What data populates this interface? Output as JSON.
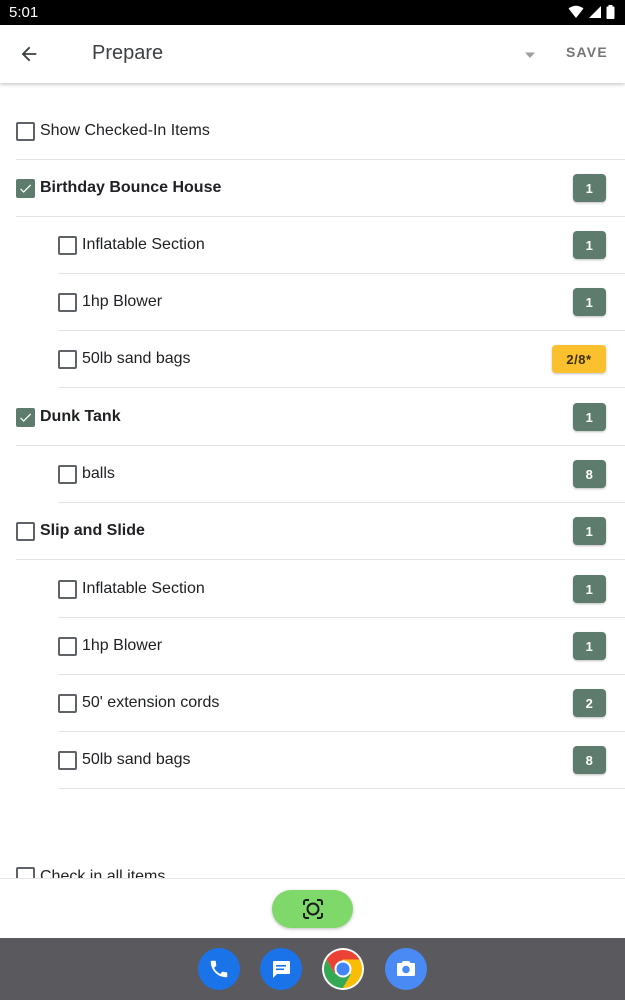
{
  "status_bar": {
    "time": "5:01"
  },
  "app_bar": {
    "title": "Prepare",
    "save_label": "SAVE"
  },
  "show_checked_in": {
    "label": "Show Checked-In Items",
    "checked": false
  },
  "groups": [
    {
      "label": "Birthday Bounce House",
      "checked": true,
      "count": "1",
      "children": [
        {
          "label": "Inflatable Section",
          "checked": false,
          "count": "1"
        },
        {
          "label": "1hp Blower",
          "checked": false,
          "count": "1"
        },
        {
          "label": "50lb sand bags",
          "checked": false,
          "count": "2/8*",
          "status": "warning"
        }
      ]
    },
    {
      "label": "Dunk Tank",
      "checked": true,
      "count": "1",
      "children": [
        {
          "label": "balls",
          "checked": false,
          "count": "8"
        }
      ]
    },
    {
      "label": "Slip and Slide",
      "checked": false,
      "count": "1",
      "children": [
        {
          "label": "Inflatable Section",
          "checked": false,
          "count": "1"
        },
        {
          "label": "1hp Blower",
          "checked": false,
          "count": "1"
        },
        {
          "label": "50' extension cords",
          "checked": false,
          "count": "2"
        },
        {
          "label": "50lb sand bags",
          "checked": false,
          "count": "8"
        }
      ]
    }
  ],
  "check_in_all": {
    "label": "Check in all items",
    "checked": false
  },
  "colors": {
    "accent": "#5d7c6e",
    "warning": "#fbc02d",
    "scan_button": "#7ed86a",
    "nav_bar": "#59595e"
  },
  "dock": [
    {
      "icon": "phone-icon"
    },
    {
      "icon": "messages-icon"
    },
    {
      "icon": "chrome-icon"
    },
    {
      "icon": "camera-icon"
    }
  ]
}
